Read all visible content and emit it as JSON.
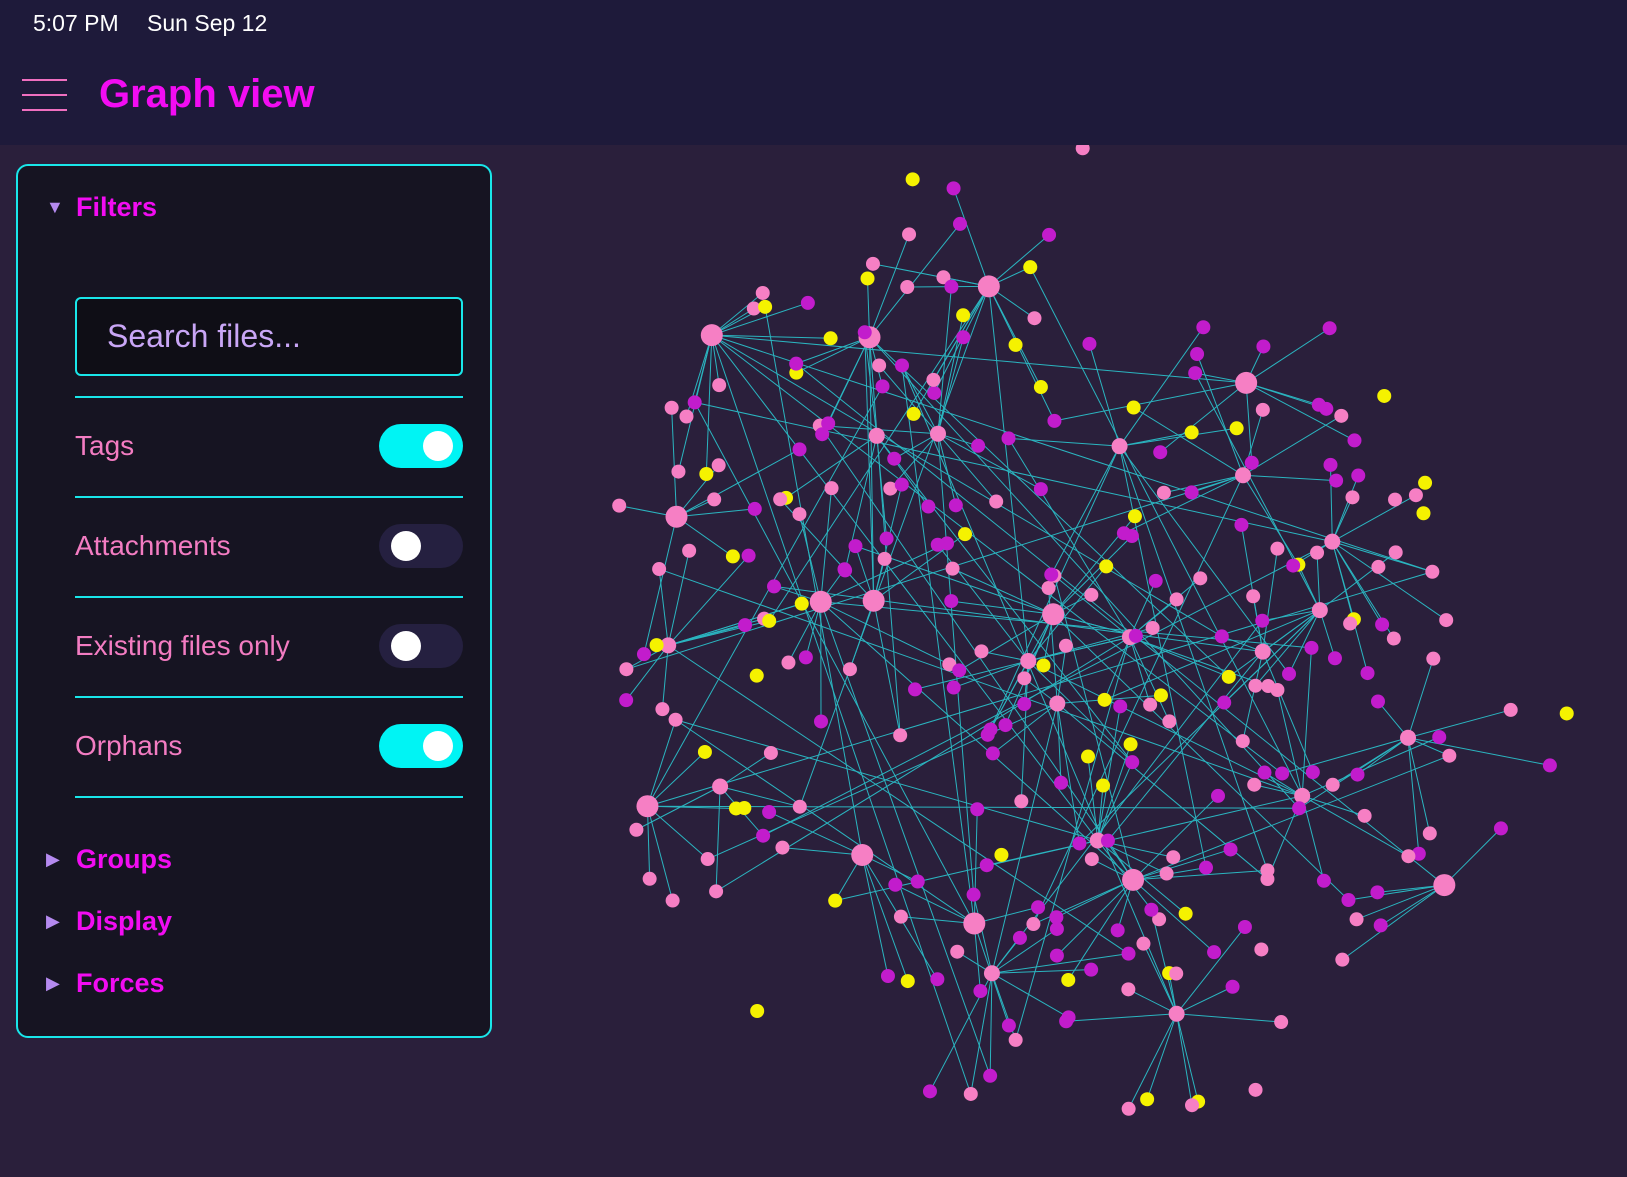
{
  "status_bar": {
    "time": "5:07 PM",
    "date": "Sun Sep 12"
  },
  "header": {
    "title": "Graph view",
    "menu_icon": "hamburger-icon"
  },
  "panel": {
    "filters": {
      "label": "Filters",
      "expanded": true,
      "search_placeholder": "Search files...",
      "toggles": [
        {
          "label": "Tags",
          "on": true
        },
        {
          "label": "Attachments",
          "on": false
        },
        {
          "label": "Existing files only",
          "on": false
        },
        {
          "label": "Orphans",
          "on": true
        }
      ]
    },
    "sections": [
      {
        "label": "Groups",
        "expanded": false
      },
      {
        "label": "Display",
        "expanded": false
      },
      {
        "label": "Forces",
        "expanded": false
      }
    ]
  },
  "colors": {
    "accent": "#f20cf2",
    "border": "#19e6ea",
    "edge": "#2bb5c0",
    "node_note": "#f67fc4",
    "node_tag": "#c21ccc",
    "node_attachment": "#f5f200",
    "background": "#2a1f3b"
  }
}
